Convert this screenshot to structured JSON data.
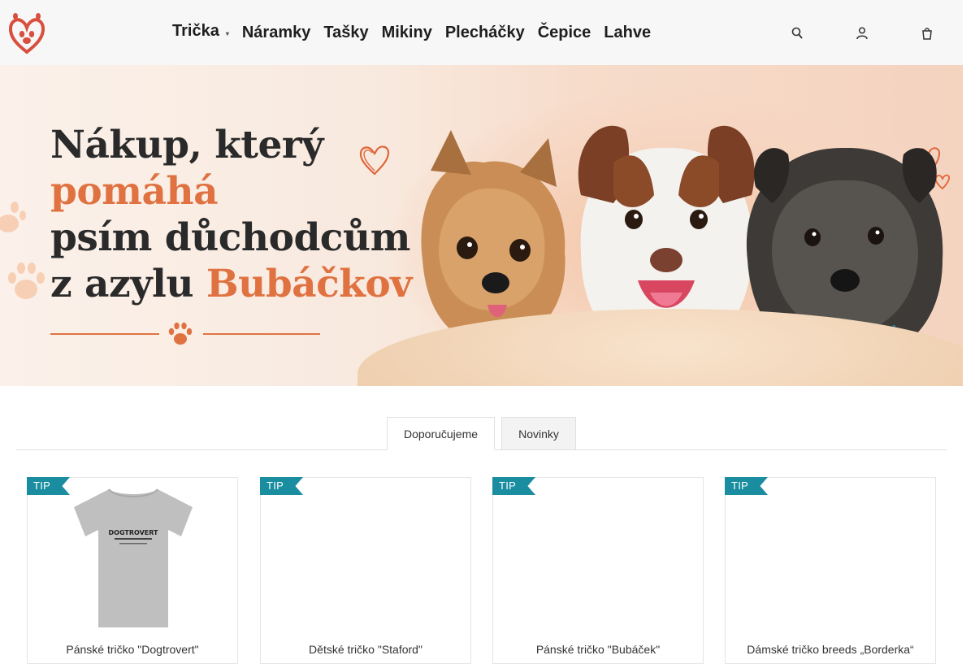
{
  "header": {
    "logo_icon": "heart-paw-logo-icon",
    "nav": [
      {
        "label": "Trička",
        "has_dropdown": true,
        "caret_icon": "chevron-down-icon"
      },
      {
        "label": "Náramky"
      },
      {
        "label": "Tašky"
      },
      {
        "label": "Mikiny"
      },
      {
        "label": "Plecháčky"
      },
      {
        "label": "Čepice"
      },
      {
        "label": "Lahve"
      }
    ],
    "icons": [
      "search-icon",
      "user-icon",
      "cart-icon"
    ]
  },
  "hero": {
    "line1": "Nákup, který",
    "line2_accent": "pomáhá",
    "line3": "psím důchodcům",
    "line4_prefix": "z azylu",
    "line4_accent": "Bubáčkov",
    "accent_color": "#e07241"
  },
  "tabs": [
    {
      "label": "Doporučujeme",
      "active": true
    },
    {
      "label": "Novinky",
      "active": false
    }
  ],
  "products": [
    {
      "badge": "TIP",
      "name": "Pánské tričko \"Dogtrovert\"",
      "image": "grey-tshirt"
    },
    {
      "badge": "TIP",
      "name": "Dětské tričko \"Staford\"",
      "image": ""
    },
    {
      "badge": "TIP",
      "name": "Pánské tričko \"Bubáček\"",
      "image": ""
    },
    {
      "badge": "TIP",
      "name": "Dámské tričko breeds „Borderka“",
      "image": ""
    }
  ],
  "tshirt_print": {
    "brand": "DOGTROVERT"
  },
  "colors": {
    "badge": "#1a8ea0",
    "accent": "#e07241",
    "header_bg": "#f7f7f7"
  }
}
